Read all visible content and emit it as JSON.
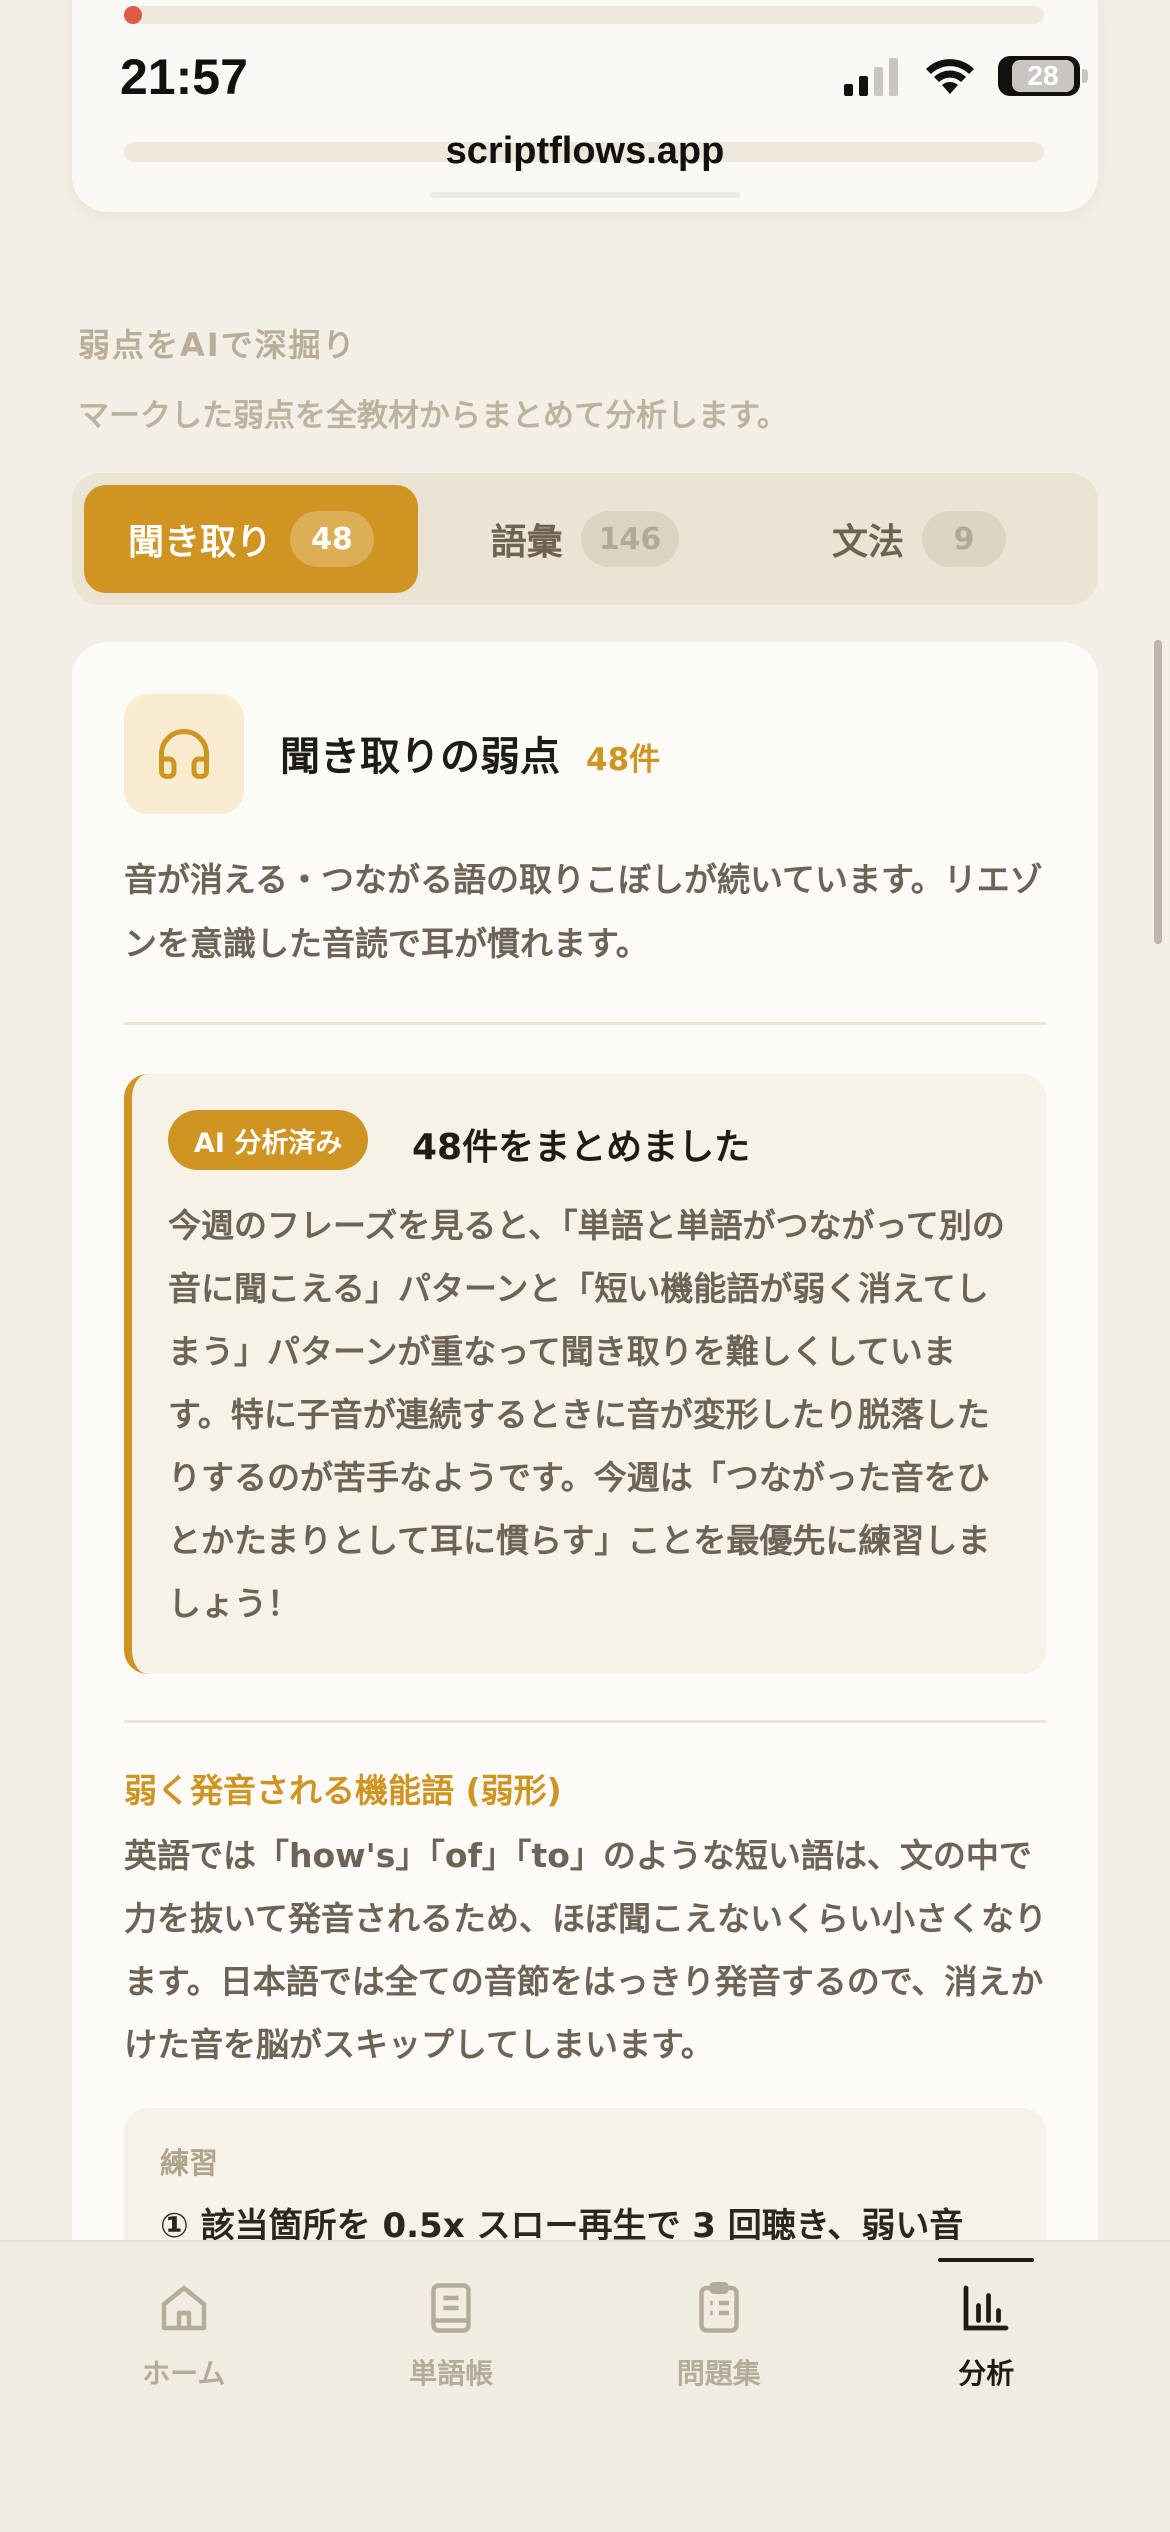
{
  "status": {
    "time": "21:57",
    "battery": "28",
    "url": "scriptflows.app"
  },
  "section": {
    "title": "弱点をAIで深掘り",
    "subtitle": "マークした弱点を全教材からまとめて分析します。"
  },
  "tabs": [
    {
      "label": "聞き取り",
      "count": "48",
      "active": true
    },
    {
      "label": "語彙",
      "count": "146",
      "active": false
    },
    {
      "label": "文法",
      "count": "9",
      "active": false
    }
  ],
  "card": {
    "icon": "headphones-icon",
    "title": "聞き取りの弱点",
    "count": "48件",
    "description": "音が消える・つながる語の取りこぼしが続いています。リエゾンを意識した音読で耳が慣れます。",
    "ai": {
      "badge": "AI 分析済み",
      "title": "48件をまとめました",
      "body": "今週のフレーズを見ると、「単語と単語がつながって別の音に聞こえる」パターンと「短い機能語が弱く消えてしまう」パターンが重なって聞き取りを難しくしています。特に子音が連続するときに音が変形したり脱落したりするのが苦手なようです。今週は「つながった音をひとかたまりとして耳に慣らす」ことを最優先に練習しましょう！"
    },
    "subsection": {
      "heading": "弱く発音される機能語 (弱形)",
      "body": "英語では「how's」「of」「to」のような短い語は、文の中で力を抜いて発音されるため、ほぼ聞こえないくらい小さくなります。日本語では全ての音節をはっきり発音するので、消えかけた音を脳がスキップしてしまいます。"
    },
    "practice": {
      "label": "練習",
      "text": "① 該当箇所を 0.5x スロー再生で 3 回聴き、弱い音"
    }
  },
  "nav": [
    {
      "label": "ホーム",
      "icon": "home-icon",
      "active": false
    },
    {
      "label": "単語帳",
      "icon": "book-icon",
      "active": false
    },
    {
      "label": "問題集",
      "icon": "clipboard-icon",
      "active": false
    },
    {
      "label": "分析",
      "icon": "bar-chart-icon",
      "active": true
    }
  ],
  "colors": {
    "accent": "#cf9422",
    "background": "#f3efe6",
    "card": "#fdfbf7"
  }
}
